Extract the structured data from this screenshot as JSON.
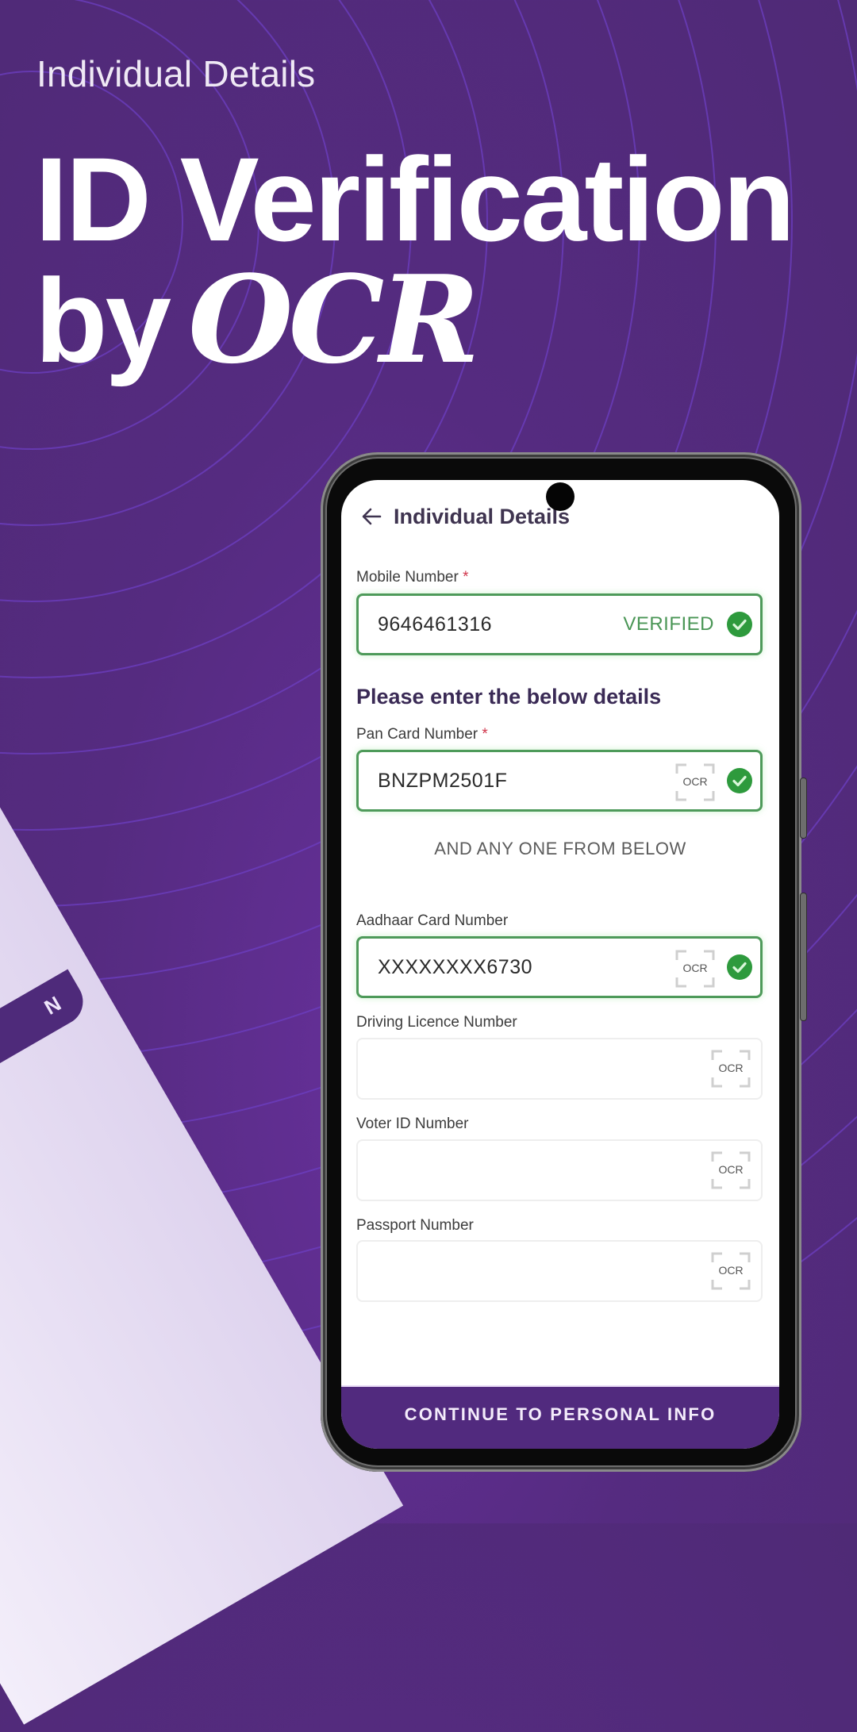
{
  "banner": {
    "subtitle": "Individual Details",
    "headline_line1": "ID Verification",
    "headline_line2_prefix": "by",
    "headline_line2_emphasis": "OCR"
  },
  "left_phone": {
    "button_fragment": "N"
  },
  "app": {
    "header": {
      "title": "Individual Details",
      "back_icon": "arrow-left-icon"
    },
    "mobile": {
      "label": "Mobile Number",
      "required_mark": "*",
      "value": "9646461316",
      "status": "VERIFIED",
      "status_icon": "check-circle-icon"
    },
    "section_title": "Please enter the below details",
    "pan": {
      "label": "Pan Card Number",
      "required_mark": "*",
      "value": "BNZPM2501F",
      "ocr_label": "OCR",
      "verified": true
    },
    "separator_text": "AND ANY ONE FROM BELOW",
    "aadhaar": {
      "label": "Aadhaar Card Number",
      "value": "XXXXXXXX6730",
      "ocr_label": "OCR",
      "verified": true
    },
    "driving_licence": {
      "label": "Driving Licence Number",
      "value": "",
      "ocr_label": "OCR"
    },
    "voter_id": {
      "label": "Voter ID Number",
      "value": "",
      "ocr_label": "OCR"
    },
    "passport": {
      "label": "Passport Number",
      "value": "",
      "ocr_label": "OCR"
    },
    "cta_label": "CONTINUE TO PERSONAL INFO"
  },
  "colors": {
    "background": "#552b80",
    "ring": "#6c3fc2",
    "verified_green": "#2e9a3d",
    "field_border_ok": "#4e9a5a",
    "cta_background": "#512a7e"
  }
}
